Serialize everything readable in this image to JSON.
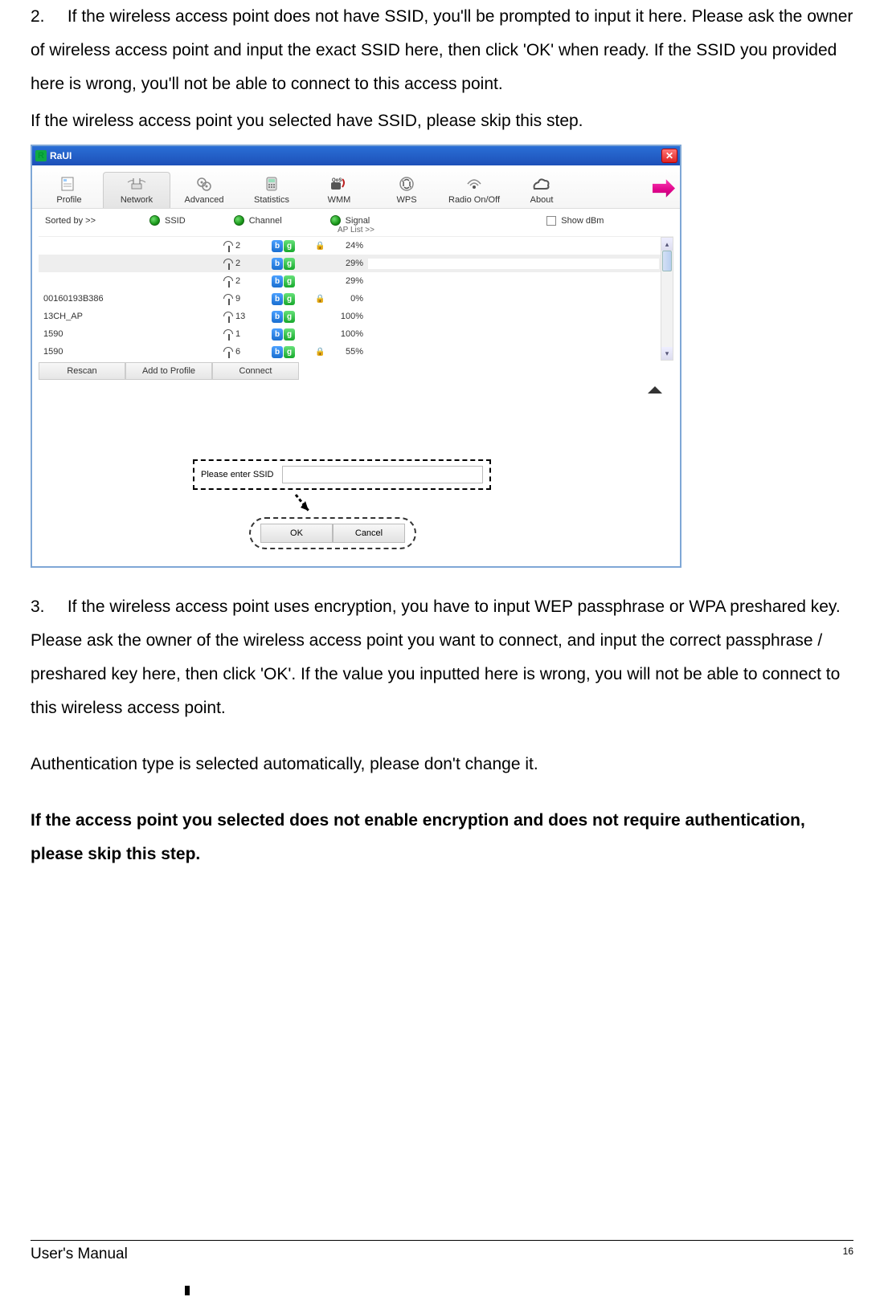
{
  "step2_num": "2.",
  "step2_text": "If the wireless access point does not have SSID, you'll be prompted to input it here. Please ask the owner of wireless access point and input the exact SSID here, then click 'OK' when ready. If the SSID you provided here is wrong, you'll not be able to connect to this access point.",
  "step2_skip": "If the wireless access point you selected have SSID, please skip this step.",
  "window": {
    "title": "RaUI",
    "tabs": [
      "Profile",
      "Network",
      "Advanced",
      "Statistics",
      "WMM",
      "WPS",
      "Radio On/Off",
      "About"
    ],
    "sort_label": "Sorted by >>",
    "sort_options": [
      "SSID",
      "Channel",
      "Signal"
    ],
    "show_dbm": "Show dBm",
    "ap_list_label": "AP List >>",
    "rows": [
      {
        "ssid": "",
        "ch": "2",
        "lock": true,
        "pct": "24%",
        "bar": 24,
        "sel": false
      },
      {
        "ssid": "",
        "ch": "2",
        "lock": false,
        "pct": "29%",
        "bar": 29,
        "sel": true
      },
      {
        "ssid": "",
        "ch": "2",
        "lock": false,
        "pct": "29%",
        "bar": 29,
        "sel": false
      },
      {
        "ssid": "00160193B386",
        "ch": "9",
        "lock": true,
        "pct": "0%",
        "bar": 0,
        "sel": false
      },
      {
        "ssid": "13CH_AP",
        "ch": "13",
        "lock": false,
        "pct": "100%",
        "bar": 100,
        "sel": false
      },
      {
        "ssid": "1590",
        "ch": "1",
        "lock": false,
        "pct": "100%",
        "bar": 100,
        "sel": false
      },
      {
        "ssid": "1590",
        "ch": "6",
        "lock": true,
        "pct": "55%",
        "bar": 55,
        "sel": false
      }
    ],
    "buttons": [
      "Rescan",
      "Add to Profile",
      "Connect"
    ],
    "ssid_prompt": "Please enter SSID",
    "ok": "OK",
    "cancel": "Cancel"
  },
  "step3_num": "3.",
  "step3_text": "If the wireless access point uses encryption, you have to input WEP passphrase or WPA preshared key. Please ask the owner of the wireless access point you want to connect, and input the correct passphrase / preshared key here, then click 'OK'. If the value you inputted here is wrong, you will not be able to connect to this wireless access point.",
  "auth_note": "Authentication type is selected automatically, please don't change it.",
  "skip_bold": "If the access point you selected does not enable encryption and does not require authentication, please skip this step.",
  "footer_title": "User's Manual",
  "page_num": "16"
}
